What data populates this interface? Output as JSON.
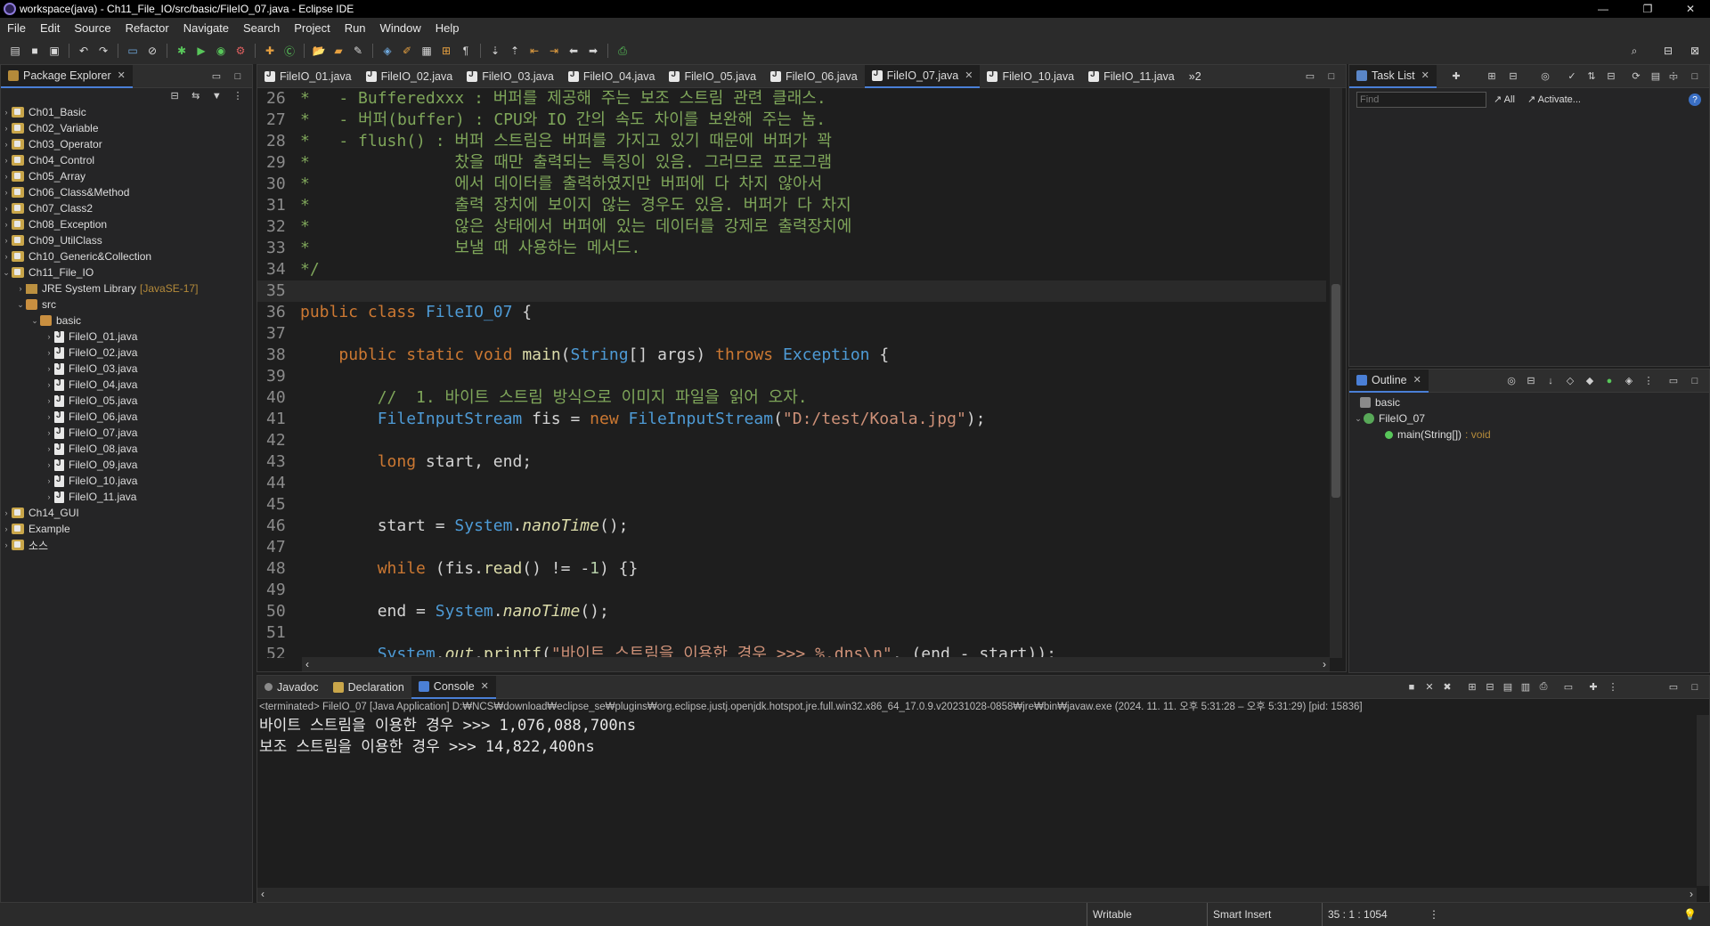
{
  "window": {
    "title": "workspace(java) - Ch11_File_IO/src/basic/FileIO_07.java - Eclipse IDE",
    "minimize": "—",
    "maximize": "❐",
    "close": "✕"
  },
  "menu": [
    "File",
    "Edit",
    "Source",
    "Refactor",
    "Navigate",
    "Search",
    "Project",
    "Run",
    "Window",
    "Help"
  ],
  "explorer": {
    "title": "Package Explorer",
    "projects_top": [
      "Ch01_Basic",
      "Ch02_Variable",
      "Ch03_Operator",
      "Ch04_Control",
      "Ch05_Array",
      "Ch06_Class&Method",
      "Ch07_Class2",
      "Ch08_Exception",
      "Ch09_UtilClass",
      "Ch10_Generic&Collection",
      "Ch11_File_IO"
    ],
    "jre_label": "JRE System Library",
    "jre_version": "[JavaSE-17]",
    "src": "src",
    "package": "basic",
    "files": [
      "FileIO_01.java",
      "FileIO_02.java",
      "FileIO_03.java",
      "FileIO_04.java",
      "FileIO_05.java",
      "FileIO_06.java",
      "FileIO_07.java",
      "FileIO_08.java",
      "FileIO_09.java",
      "FileIO_10.java",
      "FileIO_11.java"
    ],
    "projects_bottom": [
      "Ch14_GUI",
      "Example",
      "소스"
    ]
  },
  "editor": {
    "tabs": [
      "FileIO_01.java",
      "FileIO_02.java",
      "FileIO_03.java",
      "FileIO_04.java",
      "FileIO_05.java",
      "FileIO_06.java",
      "FileIO_07.java",
      "FileIO_10.java",
      "FileIO_11.java"
    ],
    "active_tab": "FileIO_07.java",
    "overflow": "»2",
    "lines": [
      {
        "n": "26",
        "t": "*   - Bufferedxxx : 버퍼를 제공해 주는 보조 스트림 관련 클래스."
      },
      {
        "n": "27",
        "t": "*   - 버퍼(buffer) : CPU와 IO 간의 속도 차이를 보완해 주는 놈."
      },
      {
        "n": "28",
        "t": "*   - flush() : 버퍼 스트림은 버퍼를 가지고 있기 때문에 버퍼가 꽉"
      },
      {
        "n": "29",
        "t": "*               찼을 때만 출력되는 특징이 있음. 그러므로 프로그램"
      },
      {
        "n": "30",
        "t": "*               에서 데이터를 출력하였지만 버퍼에 다 차지 않아서"
      },
      {
        "n": "31",
        "t": "*               출력 장치에 보이지 않는 경우도 있음. 버퍼가 다 차지"
      },
      {
        "n": "32",
        "t": "*               않은 상태에서 버퍼에 있는 데이터를 강제로 출력장치에"
      },
      {
        "n": "33",
        "t": "*               보낼 때 사용하는 메서드."
      },
      {
        "n": "34",
        "t": "*/"
      },
      {
        "n": "35",
        "t": ""
      },
      {
        "n": "36",
        "t": "public class FileIO_07 {"
      },
      {
        "n": "37",
        "t": ""
      },
      {
        "n": "38",
        "t": "    public static void main(String[] args) throws Exception {"
      },
      {
        "n": "39",
        "t": ""
      },
      {
        "n": "40",
        "t": "        //  1. 바이트 스트림 방식으로 이미지 파일을 읽어 오자."
      },
      {
        "n": "41",
        "t": "        FileInputStream fis = new FileInputStream(\"D:/test/Koala.jpg\");"
      },
      {
        "n": "42",
        "t": ""
      },
      {
        "n": "43",
        "t": "        long start, end;"
      },
      {
        "n": "44",
        "t": ""
      },
      {
        "n": "45",
        "t": ""
      },
      {
        "n": "46",
        "t": "        start = System.nanoTime();"
      },
      {
        "n": "47",
        "t": ""
      },
      {
        "n": "48",
        "t": "        while (fis.read() != -1) {}"
      },
      {
        "n": "49",
        "t": ""
      },
      {
        "n": "50",
        "t": "        end = System.nanoTime();"
      },
      {
        "n": "51",
        "t": ""
      },
      {
        "n": "52",
        "t": "        System.out.printf(\"바이트 스트림을 이용한 경우 >>> %,dns\\n\", (end - start));"
      }
    ]
  },
  "tasklist": {
    "title": "Task List",
    "find_placeholder": "Find",
    "all": "All",
    "activate": "Activate..."
  },
  "outline": {
    "title": "Outline",
    "package": "basic",
    "class": "FileIO_07",
    "method": "main(String[])",
    "method_type": ": void"
  },
  "bottom": {
    "tabs": [
      "Javadoc",
      "Declaration",
      "Console"
    ],
    "active": "Console",
    "header": "<terminated> FileIO_07 [Java Application] D:₩NCS₩download₩eclipse_se₩plugins₩org.eclipse.justj.openjdk.hotspot.jre.full.win32.x86_64_17.0.9.v20231028-0858₩jre₩bin₩javaw.exe  (2024. 11. 11. 오후 5:31:28 – 오후 5:31:29) [pid: 15836]",
    "output": [
      "바이트 스트림을 이용한 경우 >>> 1,076,088,700ns",
      "보조 스트림을 이용한 경우 >>> 14,822,400ns"
    ]
  },
  "status": {
    "writable": "Writable",
    "insert": "Smart Insert",
    "position": "35 : 1 : 1054"
  }
}
